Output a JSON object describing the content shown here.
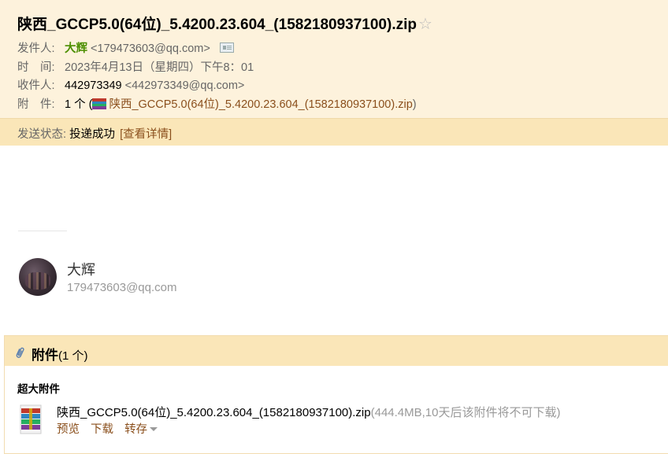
{
  "email": {
    "subject": "陕西_GCCP5.0(64位)_5.4200.23.604_(1582180937100).zip",
    "star_icon": "star-outline-icon",
    "from_label": "发件人:",
    "from_name": "大辉",
    "from_address": "<179473603@qq.com>",
    "time_label": "时　间:",
    "time_value": "2023年4月13日（星期四）下午8：01",
    "to_label": "收件人:",
    "to_name": "442973349",
    "to_address": "<442973349@qq.com>",
    "attach_label": "附　件:",
    "attach_count_prefix": "1 个 (",
    "attach_file": "陕西_GCCP5.0(64位)_5.4200.23.604_(1582180937100).zip",
    "attach_count_suffix": ")"
  },
  "status": {
    "label": "发送状态:",
    "value": "投递成功",
    "link": "[查看详情]"
  },
  "signature": {
    "name": "大辉",
    "email": "179473603@qq.com"
  },
  "attachments": {
    "title": "附件",
    "count": "(1 个)",
    "section": "超大附件",
    "file_name": "陕西_GCCP5.0(64位)_5.4200.23.604_(1582180937100).zip",
    "file_info": "(444.4MB,10天后该附件将不可下载)",
    "preview": "预览",
    "download": "下载",
    "forward": "转存"
  }
}
